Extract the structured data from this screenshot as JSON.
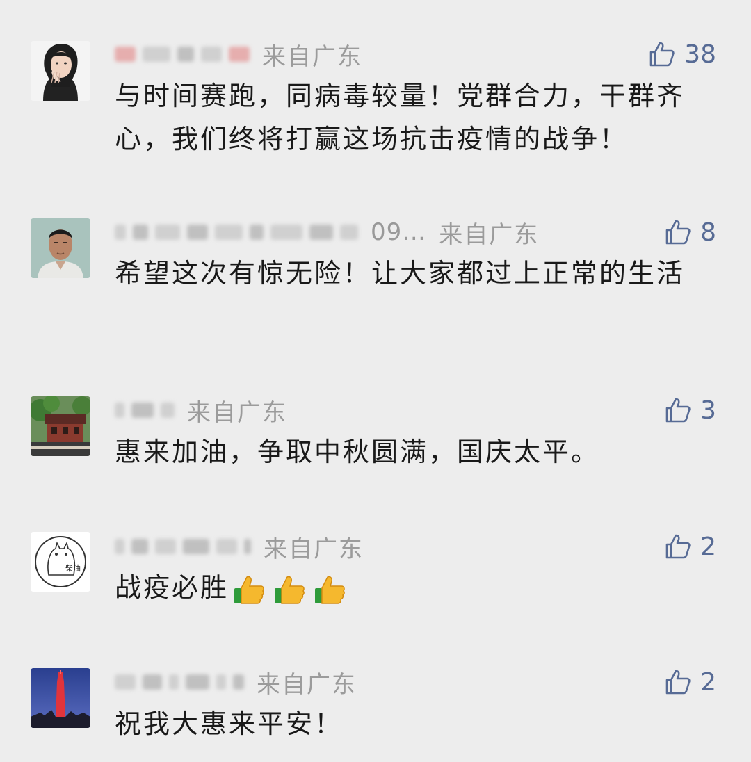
{
  "comments": [
    {
      "name_tail": "",
      "location": "来自广东",
      "likes": "38",
      "text": "与时间赛跑，同病毒较量！党群合力，干群齐心，我们终将打赢这场抗击疫情的战争！",
      "avatar_icon": "woman-avatar-icon",
      "emoji_count": 0
    },
    {
      "name_tail": "09…",
      "location": "来自广东",
      "likes": "8",
      "text": "希望这次有惊无险！让大家都过上正常的生活",
      "avatar_icon": "man-portrait-avatar-icon",
      "emoji_count": 0
    },
    {
      "name_tail": "",
      "location": "来自广东",
      "likes": "3",
      "text": "惠来加油，争取中秋圆满，国庆太平。",
      "avatar_icon": "temple-avatar-icon",
      "emoji_count": 0
    },
    {
      "name_tail": "",
      "location": "来自广东",
      "likes": "2",
      "text": "战疫必胜",
      "avatar_icon": "totoro-logo-avatar-icon",
      "avatar_text": "柴油",
      "emoji_count": 3,
      "emoji_icon": "thumbs-up-emoji-icon"
    },
    {
      "name_tail": "",
      "location": "来自广东",
      "likes": "2",
      "text": "祝我大惠来平安！",
      "avatar_icon": "red-tower-night-avatar-icon",
      "emoji_count": 0
    }
  ],
  "colors": {
    "background": "#ededed",
    "like_blue": "#576b95",
    "meta_gray": "#9b9b9b",
    "text": "#191919"
  }
}
